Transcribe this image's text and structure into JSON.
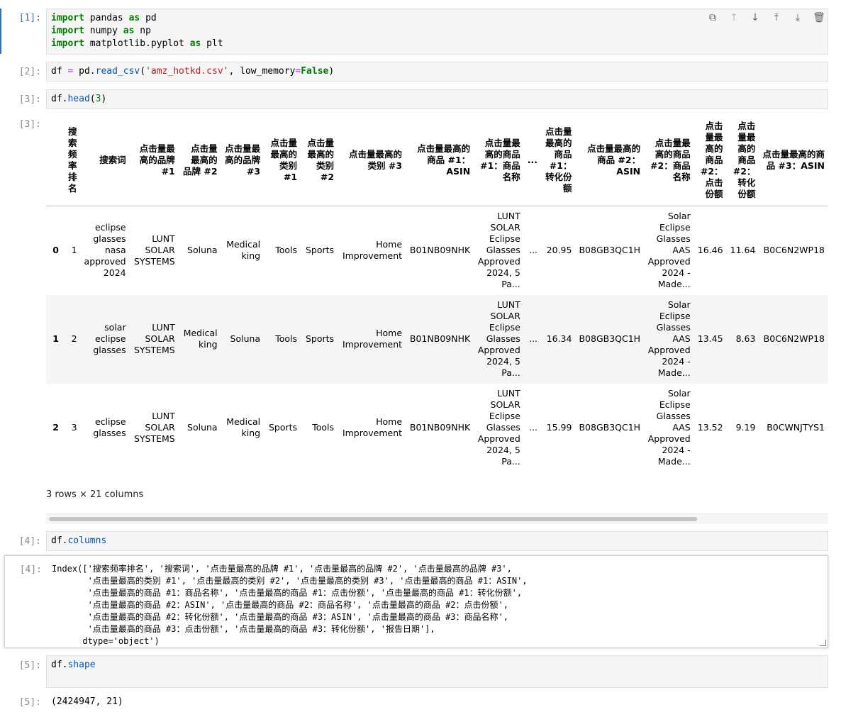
{
  "cells": [
    {
      "prompt": "[1]:",
      "lines": [
        [
          {
            "t": "import",
            "c": "kw"
          },
          {
            "t": " pandas "
          },
          {
            "t": "as",
            "c": "kw"
          },
          {
            "t": " pd"
          }
        ],
        [
          {
            "t": "import",
            "c": "kw"
          },
          {
            "t": " numpy "
          },
          {
            "t": "as",
            "c": "kw"
          },
          {
            "t": " np"
          }
        ],
        [
          {
            "t": "import",
            "c": "kw"
          },
          {
            "t": " matplotlib.pyplot "
          },
          {
            "t": "as",
            "c": "kw"
          },
          {
            "t": " plt"
          }
        ]
      ]
    },
    {
      "prompt": "[2]:",
      "lines": [
        [
          {
            "t": "df "
          },
          {
            "t": "=",
            "c": "op"
          },
          {
            "t": " pd."
          },
          {
            "t": "read_csv",
            "c": "fn"
          },
          {
            "t": "("
          },
          {
            "t": "'amz_hotkd.csv'",
            "c": "str"
          },
          {
            "t": ", low_memory"
          },
          {
            "t": "=",
            "c": "op"
          },
          {
            "t": "False",
            "c": "kw"
          },
          {
            "t": ")"
          }
        ]
      ]
    },
    {
      "prompt": "[3]:",
      "lines": [
        [
          {
            "t": "df."
          },
          {
            "t": "head",
            "c": "fn"
          },
          {
            "t": "("
          },
          {
            "t": "3",
            "c": "num"
          },
          {
            "t": ")"
          }
        ]
      ]
    },
    {
      "prompt": "[4]:",
      "lines": [
        [
          {
            "t": "df."
          },
          {
            "t": "columns",
            "c": "fn"
          }
        ]
      ]
    },
    {
      "prompt": "[5]:",
      "lines": [
        [
          {
            "t": "df."
          },
          {
            "t": "shape",
            "c": "fn"
          }
        ]
      ]
    }
  ],
  "toolbar": {
    "icons": [
      "duplicate-icon",
      "move-up-icon",
      "move-down-icon",
      "insert-above-icon",
      "insert-below-icon",
      "delete-icon"
    ],
    "glyphs": [
      "⧉",
      "↑",
      "↓",
      "⤒",
      "⤓",
      "🗑"
    ]
  },
  "output3": {
    "prompt": "[3]:",
    "headers": [
      "",
      "搜索频率排名",
      "搜索词",
      "点击量最高的品牌 #1",
      "点击量最高的品牌 #2",
      "点击量最高的品牌 #3",
      "点击量最高的类别 #1",
      "点击量最高的类别 #2",
      "点击量最高的类别 #3",
      "点击量最高的商品 #1：ASIN",
      "点击量最高的商品 #1：商品名称",
      "...",
      "点击量最高的商品 #1：转化份额",
      "点击量最高的商品 #2：ASIN",
      "点击量最高的商品 #2：商品名称",
      "点击量最高的商品 #2：点击份额",
      "点击量最高的商品 #2：转化份额",
      "点击量最高的商品 #3：ASIN"
    ],
    "rows": [
      [
        "0",
        "1",
        "eclipse glasses nasa approved 2024",
        "LUNT SOLAR SYSTEMS",
        "Soluna",
        "Medical king",
        "Tools",
        "Sports",
        "Home Improvement",
        "B01NB09NHK",
        "LUNT SOLAR Eclipse Glasses Approved 2024, 5 Pa...",
        "...",
        "20.95",
        "B08GB3QC1H",
        "Solar Eclipse Glasses AAS Approved 2024 - Made...",
        "16.46",
        "11.64",
        "B0C6N2WP18"
      ],
      [
        "1",
        "2",
        "solar eclipse glasses",
        "LUNT SOLAR SYSTEMS",
        "Medical king",
        "Soluna",
        "Tools",
        "Sports",
        "Home Improvement",
        "B01NB09NHK",
        "LUNT SOLAR Eclipse Glasses Approved 2024, 5 Pa...",
        "...",
        "16.34",
        "B08GB3QC1H",
        "Solar Eclipse Glasses AAS Approved 2024 - Made...",
        "13.45",
        "8.63",
        "B0C6N2WP18"
      ],
      [
        "2",
        "3",
        "eclipse glasses",
        "LUNT SOLAR SYSTEMS",
        "Soluna",
        "Medical king",
        "Sports",
        "Tools",
        "Home Improvement",
        "B01NB09NHK",
        "LUNT SOLAR Eclipse Glasses Approved 2024, 5 Pa...",
        "...",
        "15.99",
        "B08GB3QC1H",
        "Solar Eclipse Glasses AAS Approved 2024 - Made...",
        "13.52",
        "9.19",
        "B0CWNJTYS1"
      ]
    ],
    "shape_note": "3 rows × 21 columns"
  },
  "output4": {
    "prompt": "[4]:",
    "text": "Index(['搜索频率排名', '搜索词', '点击量最高的品牌 #1', '点击量最高的品牌 #2', '点击量最高的品牌 #3',\n       '点击量最高的类别 #1', '点击量最高的类别 #2', '点击量最高的类别 #3', '点击量最高的商品 #1：ASIN',\n       '点击量最高的商品 #1：商品名称', '点击量最高的商品 #1：点击份额', '点击量最高的商品 #1：转化份额',\n       '点击量最高的商品 #2：ASIN', '点击量最高的商品 #2：商品名称', '点击量最高的商品 #2：点击份额',\n       '点击量最高的商品 #2：转化份额', '点击量最高的商品 #3：ASIN', '点击量最高的商品 #3：商品名称',\n       '点击量最高的商品 #3：点击份额', '点击量最高的商品 #3：转化份额', '报告日期'],\n      dtype='object')"
  },
  "output5": {
    "prompt": "[5]:",
    "text": "(2424947, 21)"
  }
}
